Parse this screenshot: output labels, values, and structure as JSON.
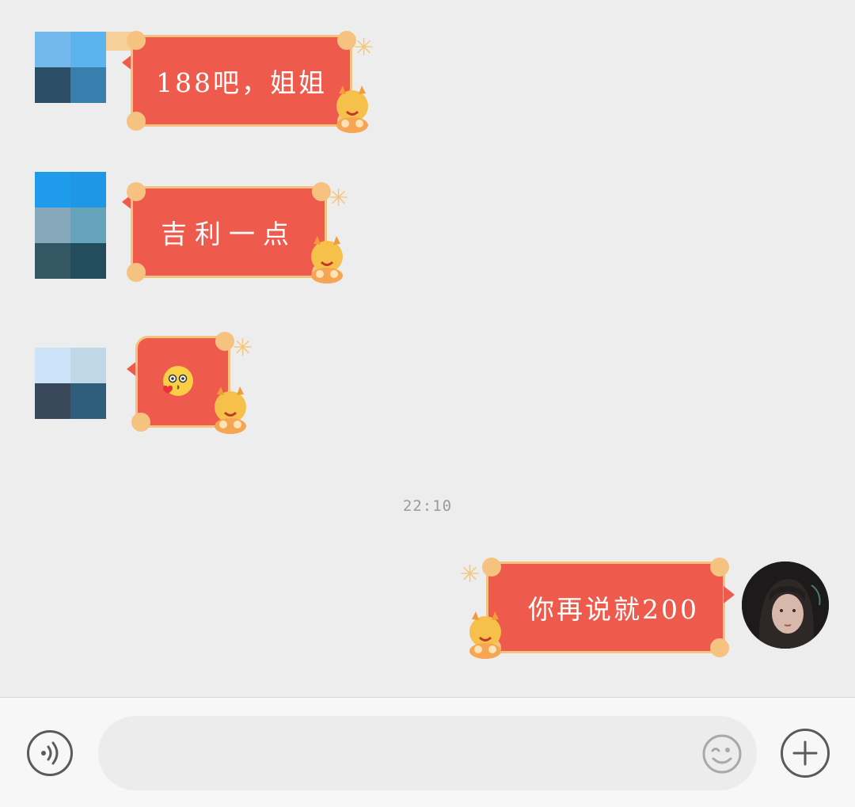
{
  "colors": {
    "chat_background": "#ededed",
    "bubble_red": "#ee5b4d",
    "bubble_border": "#f6c27f",
    "input_bar": "#f7f7f7",
    "icon_gray": "#5a5a5a"
  },
  "messages": [
    {
      "sender": "contact",
      "text": "188吧，姐姐"
    },
    {
      "sender": "contact",
      "text": "吉利一点"
    },
    {
      "sender": "contact",
      "text": "",
      "emoji": "kiss-heart-emoji"
    },
    {
      "sender": "me",
      "text": "你再说就200"
    }
  ],
  "timestamp": "22:10",
  "input_bar": {
    "placeholder": "",
    "value": "",
    "voice_icon": "voice-icon",
    "emoji_icon": "smiley-icon",
    "plus_icon": "plus-icon"
  }
}
